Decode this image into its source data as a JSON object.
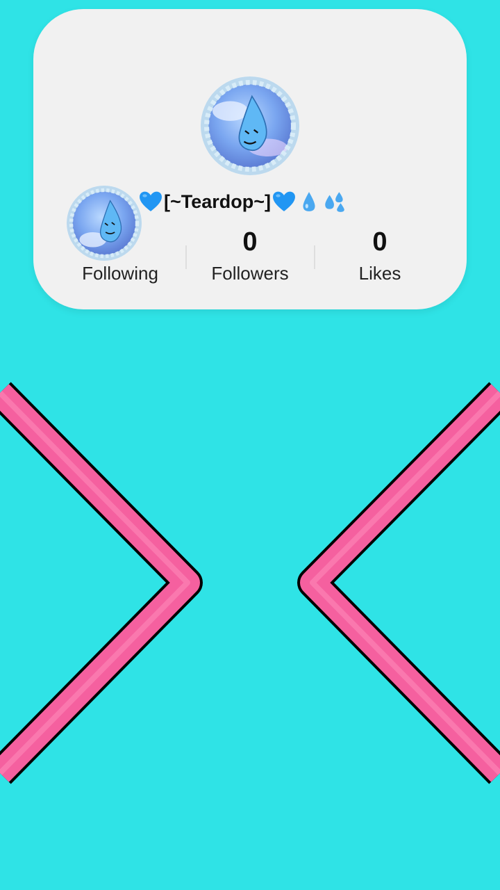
{
  "profile": {
    "username_text": "[~Teardop~]",
    "stats": {
      "following_label": "Following",
      "followers_count": "0",
      "followers_label": "Followers",
      "likes_count": "0",
      "likes_label": "Likes"
    }
  },
  "colors": {
    "background": "#2fe3e6",
    "card": "#f1f1f1",
    "arrow_pink": "#f5609f",
    "heart_blue": "#2196f3"
  },
  "icons": [
    "blue-heart-icon",
    "droplet-icon",
    "sweat-droplets-icon",
    "arrow-left-shape",
    "arrow-right-shape"
  ]
}
